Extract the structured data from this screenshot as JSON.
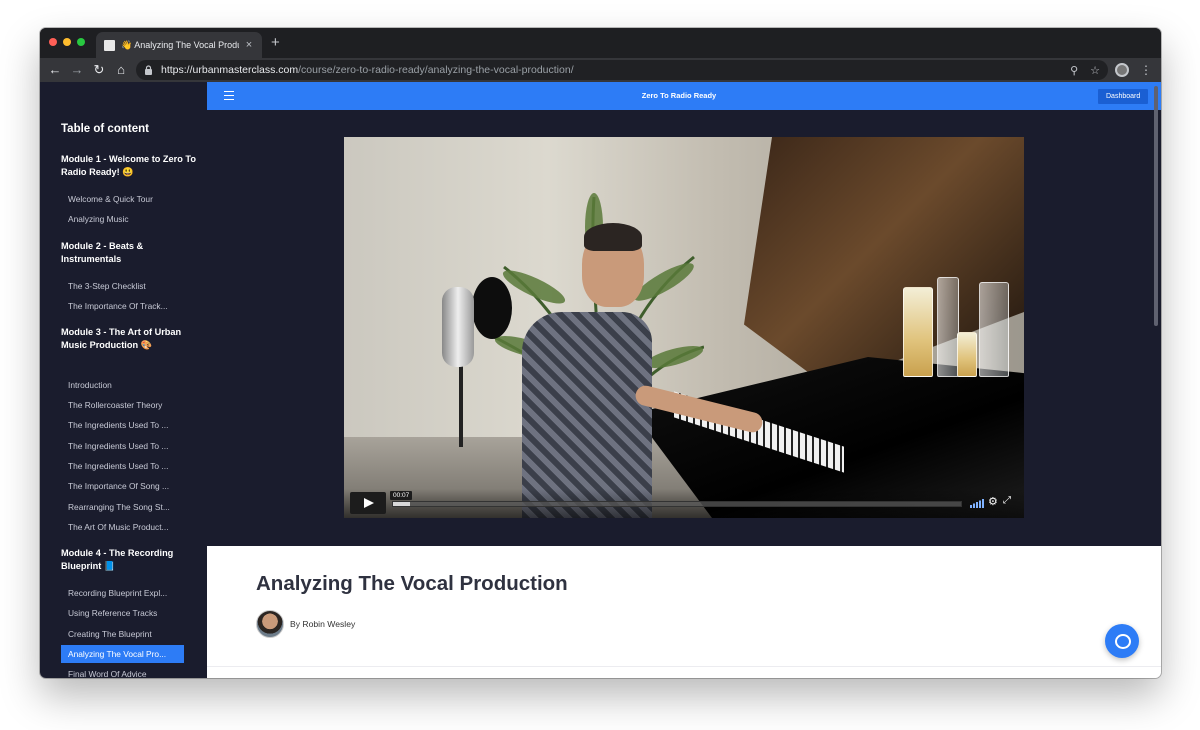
{
  "browser": {
    "tab_title": "👋 Analyzing The Vocal Production",
    "tab_close": "×",
    "new_tab": "+",
    "url_host": "https://urbanmasterclass.com",
    "url_path": "/course/zero-to-radio-ready/analyzing-the-vocal-production/",
    "icons": [
      "back-arrow-icon",
      "forward-arrow-icon",
      "reload-icon",
      "home-icon",
      "lock-icon",
      "zoom-icon",
      "star-icon",
      "extension-icon",
      "menu-dots-icon"
    ]
  },
  "sidebar": {
    "title": "Table of content",
    "modules": [
      {
        "title": "Module 1 - Welcome to Zero To Radio Ready! 😃",
        "lessons": [
          {
            "label": "Welcome & Quick Tour"
          },
          {
            "label": "Analyzing Music"
          }
        ]
      },
      {
        "title": "Module 2 - Beats & Instrumentals",
        "lessons": [
          {
            "label": "The 3-Step Checklist"
          },
          {
            "label": "The Importance Of Track..."
          }
        ]
      },
      {
        "title": "Module 3 - The Art of Urban Music Production 🎨",
        "lessons": [
          {
            "label": "Introduction"
          },
          {
            "label": "The Rollercoaster Theory"
          },
          {
            "label": "The Ingredients Used To ..."
          },
          {
            "label": "The Ingredients Used To ..."
          },
          {
            "label": "The Ingredients Used To ..."
          },
          {
            "label": "The Importance Of Song ..."
          },
          {
            "label": "Rearranging The Song St..."
          },
          {
            "label": "The Art Of Music Product..."
          }
        ]
      },
      {
        "title": "Module 4 - The Recording Blueprint 📘",
        "lessons": [
          {
            "label": "Recording Blueprint Expl..."
          },
          {
            "label": "Using Reference Tracks"
          },
          {
            "label": "Creating The Blueprint"
          },
          {
            "label": "Analyzing The Vocal Pro...",
            "active": true
          },
          {
            "label": "Final Word Of Advice"
          }
        ]
      }
    ]
  },
  "header": {
    "course_title": "Zero To Radio Ready",
    "dashboard_label": "Dashboard"
  },
  "video": {
    "current_time": "00:07",
    "progress": 0.03
  },
  "lesson": {
    "title": "Analyzing The Vocal Production",
    "author": "By Robin Wesley"
  },
  "colors": {
    "accent": "#2d7cf6",
    "sidebar_bg": "#1a1c2d",
    "title_text": "#2f3240"
  }
}
